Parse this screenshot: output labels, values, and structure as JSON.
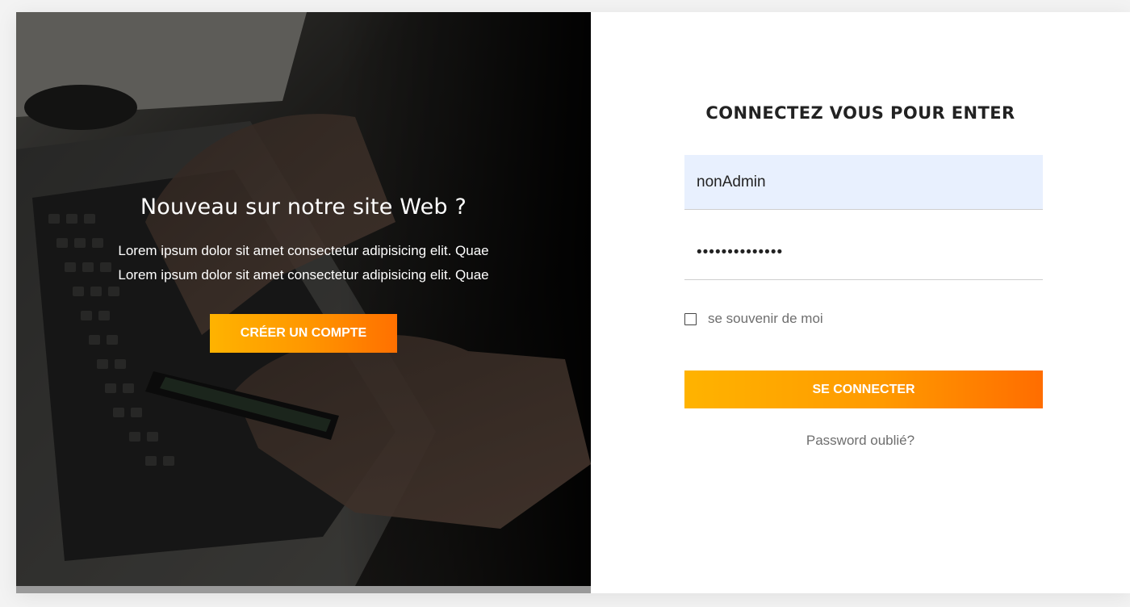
{
  "hero": {
    "title": "Nouveau sur notre site Web ?",
    "text": "Lorem ipsum dolor sit amet consectetur adipisicing elit. Quae Lorem ipsum dolor sit amet consectetur adipisicing elit. Quae",
    "create_button": "CRÉER UN COMPTE"
  },
  "login": {
    "title": "CONNECTEZ VOUS POUR ENTER",
    "username_value": "nonAdmin",
    "password_value": "passwordpasswo",
    "remember_label": "se souvenir de moi",
    "remember_checked": false,
    "submit_label": "SE CONNECTER",
    "forgot_label": "Password oublié?"
  },
  "colors": {
    "accent_start": "#ffb300",
    "accent_end": "#ff6d00",
    "autofill_bg": "#e8f0fe"
  }
}
